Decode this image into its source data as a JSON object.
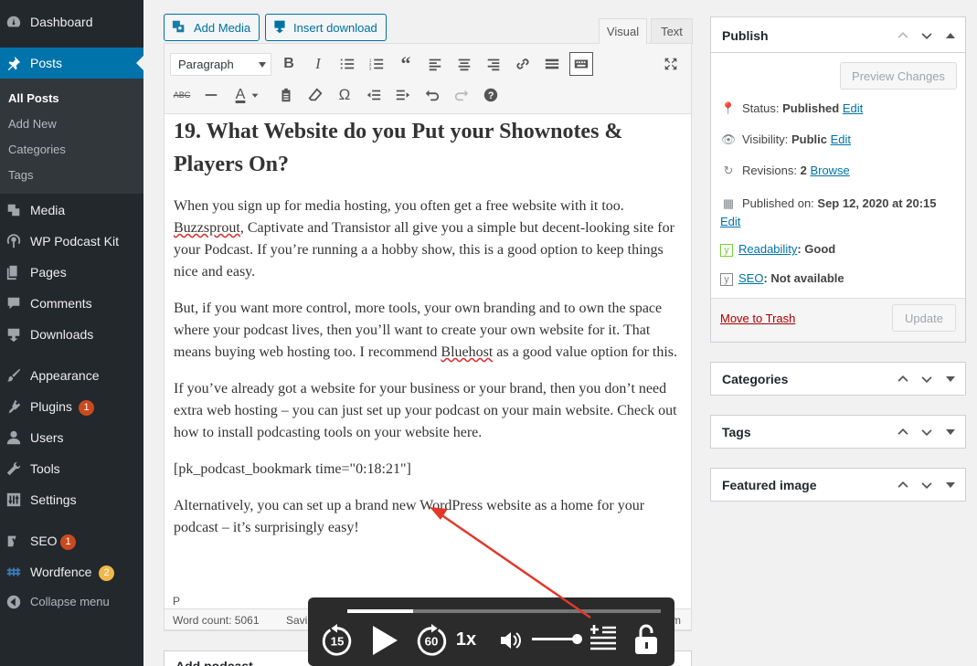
{
  "sidebar": {
    "items": [
      {
        "label": "Dashboard",
        "icon": "dashboard-icon"
      },
      {
        "label": "Posts",
        "icon": "pin-icon"
      },
      {
        "label": "Media",
        "icon": "media-icon"
      },
      {
        "label": "WP Podcast Kit",
        "icon": "podcast-icon"
      },
      {
        "label": "Pages",
        "icon": "pages-icon"
      },
      {
        "label": "Comments",
        "icon": "comments-icon"
      },
      {
        "label": "Downloads",
        "icon": "download-icon"
      },
      {
        "label": "Appearance",
        "icon": "brush-icon"
      },
      {
        "label": "Plugins",
        "icon": "plugin-icon",
        "badge": "1"
      },
      {
        "label": "Users",
        "icon": "users-icon"
      },
      {
        "label": "Tools",
        "icon": "wrench-icon"
      },
      {
        "label": "Settings",
        "icon": "settings-icon"
      },
      {
        "label": "SEO",
        "icon": "yoast-icon",
        "badge": "1"
      },
      {
        "label": "Wordfence",
        "icon": "wordfence-icon",
        "badge": "2"
      },
      {
        "label": "Collapse menu",
        "icon": "collapse-icon"
      }
    ],
    "submenu": [
      "All Posts",
      "Add New",
      "Categories",
      "Tags"
    ]
  },
  "editor": {
    "add_media": "Add Media",
    "insert_download": "Insert download",
    "tab_visual": "Visual",
    "tab_text": "Text",
    "format_select": "Paragraph",
    "heading": "19. What Website do you Put your Shownotes & Players On?",
    "p1_a": "When you sign up for media hosting, you often get a free website with it too. ",
    "p1_b": "Buzzsprout",
    "p1_c": ", Captivate and Transistor all give you a simple but decent-looking site for your Podcast. If you’re running a a hobby show, this is a good option to keep things nice and easy.",
    "p2_a": "But, if you want more control, more tools, your own branding and to own the space where your podcast lives, then you’ll want to create your own website for it. That means buying web hosting too. I recommend ",
    "p2_b": "Bluehost",
    "p2_c": " as a good value option for this.",
    "p3": "If you’ve already got a website for your business or your brand, then you don’t need extra web hosting – you can just set up your podcast on your main website. Check out how to install podcasting tools on your website here.",
    "p4": "[pk_podcast_bookmark time=\"0:18:21\"]",
    "p5": "Alternatively, you can set up a brand new WordPress website as a home for your podcast – it’s surprisingly easy!",
    "path": "P",
    "word_count": "Word count: 5061",
    "saved_partial": "Savi",
    "status_right": "m",
    "below_box": "Add podcast"
  },
  "publish": {
    "title": "Publish",
    "preview": "Preview Changes",
    "status_label": "Status: ",
    "status_value": "Published",
    "edit": "Edit",
    "visibility_label": "Visibility: ",
    "visibility_value": "Public",
    "revisions_label": "Revisions: ",
    "revisions_value": "2",
    "browse": "Browse",
    "published_on_label": "Published on: ",
    "published_on_value": "Sep 12, 2020 at 20:15",
    "readability_link": "Readability",
    "readability_value": ": Good",
    "seo_link": "SEO",
    "seo_value": ": Not available",
    "trash": "Move to Trash",
    "update": "Update"
  },
  "boxes": {
    "categories": "Categories",
    "tags": "Tags",
    "featured": "Featured image"
  },
  "player": {
    "back_seconds": "15",
    "forward_seconds": "60",
    "speed": "1x",
    "progress": 0.21,
    "volume": 1.0
  },
  "colors": {
    "sidebar": "#23282d",
    "accent": "#0073aa",
    "arrow": "#e0392b"
  }
}
